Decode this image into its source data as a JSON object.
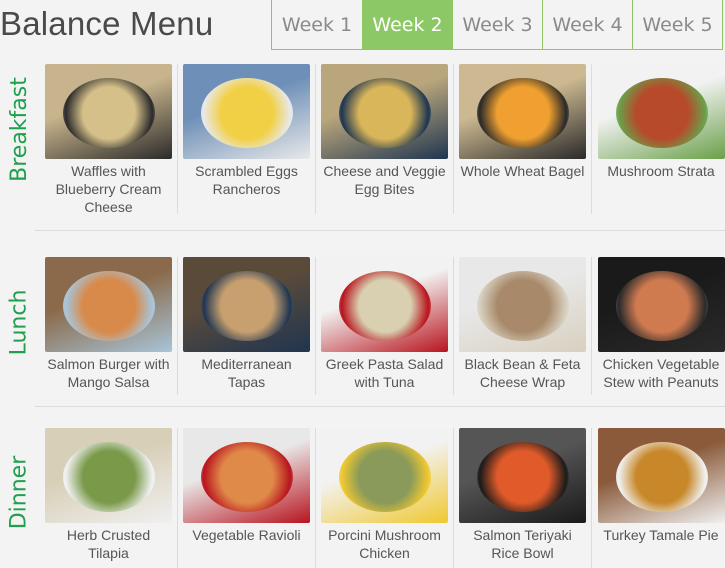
{
  "header": {
    "title": "Balance Menu",
    "tabs": [
      {
        "label": "Week 1",
        "active": false
      },
      {
        "label": "Week 2",
        "active": true
      },
      {
        "label": "Week 3",
        "active": false
      },
      {
        "label": "Week 4",
        "active": false
      },
      {
        "label": "Week 5",
        "active": false
      }
    ]
  },
  "colors": {
    "accent": "#8cc865",
    "section_label": "#1fa04f",
    "caption_text": "#555555",
    "title_text": "#4a4a4a"
  },
  "sections": [
    {
      "label": "Breakfast",
      "items": [
        {
          "name": "Waffles with Blueberry Cream Cheese",
          "lines": [
            "Waffles with",
            "Blueberry Cream",
            "Cheese"
          ],
          "image": "waffles-photo"
        },
        {
          "name": "Scrambled Eggs Rancheros",
          "lines": [
            "Scrambled Eggs",
            "Rancheros"
          ],
          "image": "scrambled-eggs-photo"
        },
        {
          "name": "Cheese and Veggie Egg Bites",
          "lines": [
            "Cheese and Veggie",
            "Egg Bites"
          ],
          "image": "egg-bites-photo"
        },
        {
          "name": "Whole Wheat Bagel",
          "lines": [
            "Whole Wheat Bagel"
          ],
          "image": "bagel-photo"
        },
        {
          "name": "Mushroom Strata",
          "lines": [
            "Mushroom Strata"
          ],
          "image": "strata-photo"
        }
      ]
    },
    {
      "label": "Lunch",
      "items": [
        {
          "name": "Salmon Burger with Mango Salsa",
          "lines": [
            "Salmon Burger with",
            "Mango Salsa"
          ],
          "image": "salmon-burger-photo"
        },
        {
          "name": "Mediterranean Tapas",
          "lines": [
            "Mediterranean",
            "Tapas"
          ],
          "image": "tapas-photo"
        },
        {
          "name": "Greek Pasta Salad with Tuna",
          "lines": [
            "Greek Pasta Salad",
            "with Tuna"
          ],
          "image": "pasta-salad-photo"
        },
        {
          "name": "Black Bean & Feta Cheese Wrap",
          "lines": [
            "Black Bean & Feta",
            "Cheese Wrap"
          ],
          "image": "wrap-photo"
        },
        {
          "name": "Chicken Vegetable Stew with Peanuts",
          "lines": [
            "Chicken Vegetable",
            "Stew with Peanuts"
          ],
          "image": "chicken-stew-photo"
        }
      ]
    },
    {
      "label": "Dinner",
      "items": [
        {
          "name": "Herb Crusted Tilapia",
          "lines": [
            "Herb Crusted",
            "Tilapia"
          ],
          "image": "tilapia-photo"
        },
        {
          "name": "Vegetable Ravioli",
          "lines": [
            "Vegetable Ravioli"
          ],
          "image": "ravioli-photo"
        },
        {
          "name": "Porcini Mushroom Chicken",
          "lines": [
            "Porcini Mushroom",
            "Chicken"
          ],
          "image": "porcini-chicken-photo"
        },
        {
          "name": "Salmon Teriyaki Rice Bowl",
          "lines": [
            "Salmon Teriyaki",
            "Rice Bowl"
          ],
          "image": "teriyaki-bowl-photo"
        },
        {
          "name": "Turkey Tamale Pie",
          "lines": [
            "Turkey Tamale Pie"
          ],
          "image": "tamale-pie-photo"
        }
      ]
    }
  ]
}
